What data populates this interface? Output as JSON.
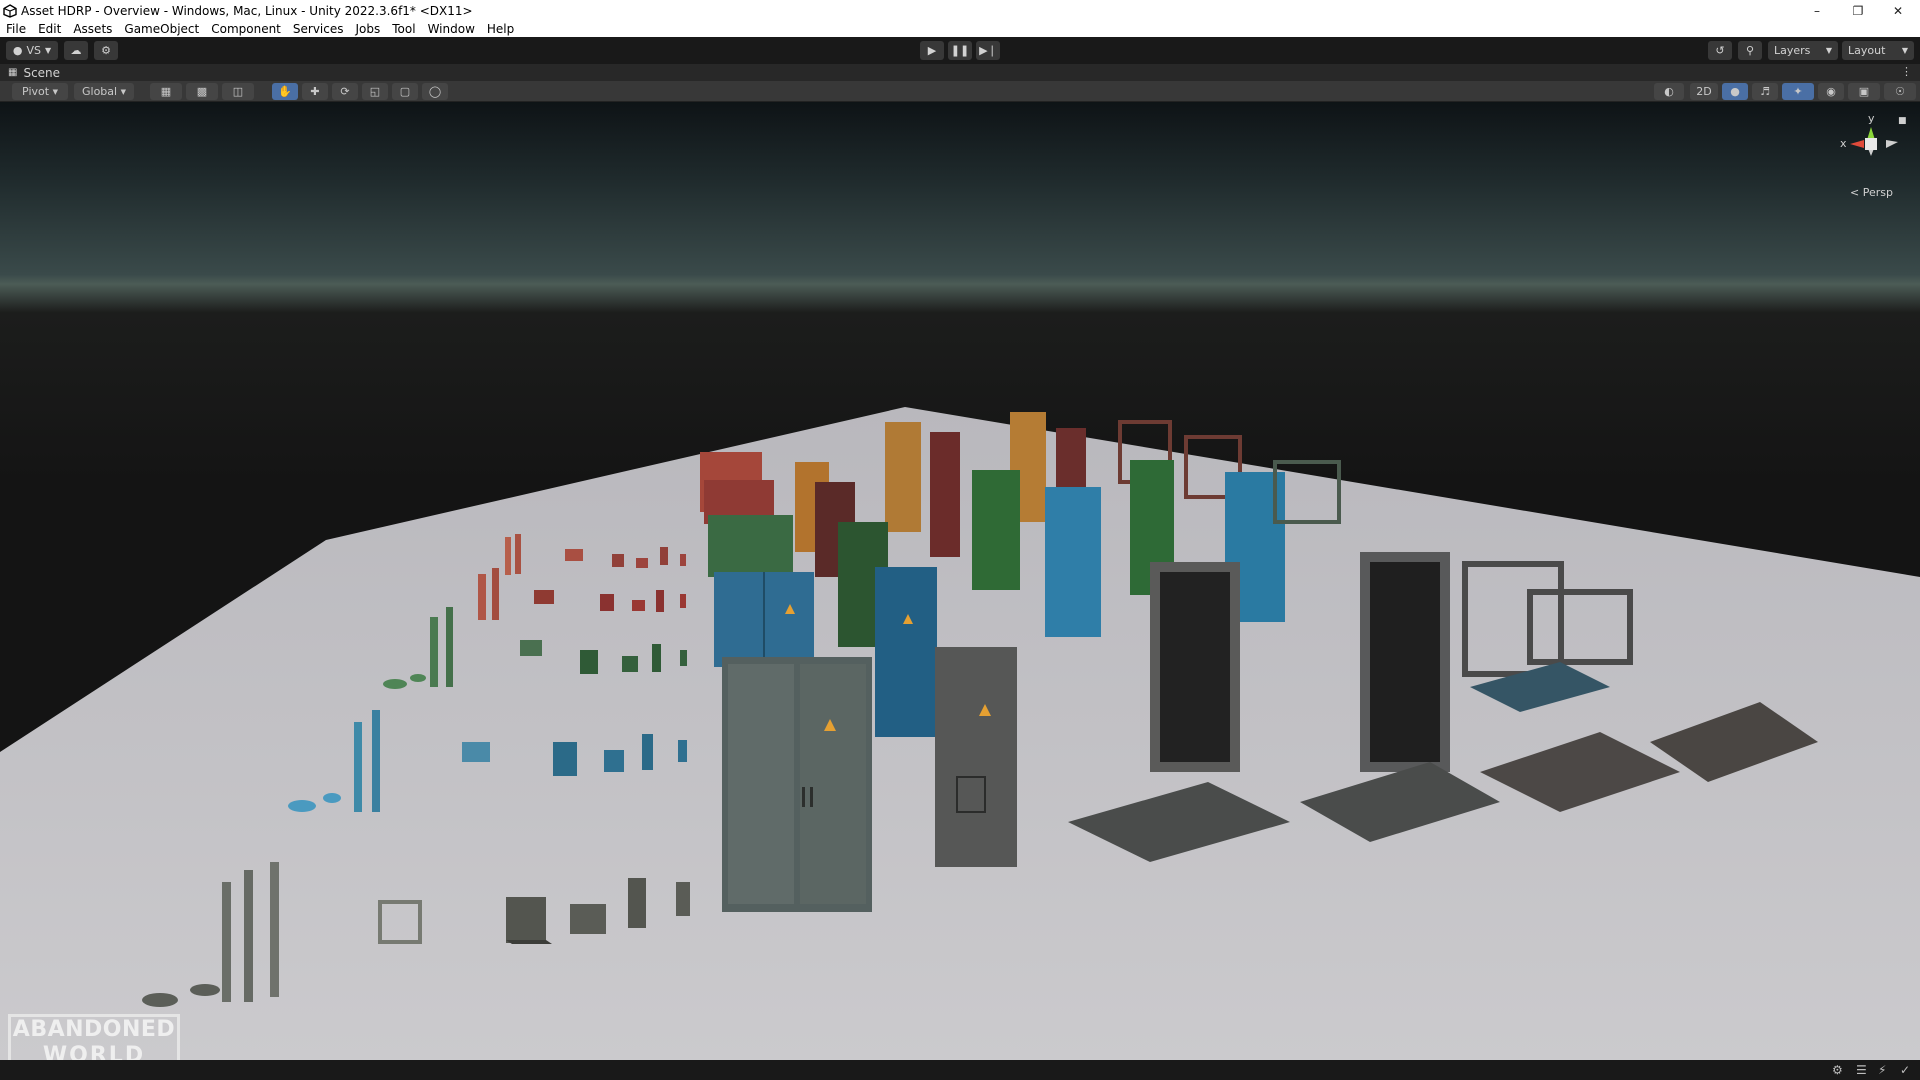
{
  "window": {
    "title": "Asset HDRP - Overview - Windows, Mac, Linux - Unity 2022.3.6f1* <DX11>"
  },
  "menu": [
    "File",
    "Edit",
    "Assets",
    "GameObject",
    "Component",
    "Services",
    "Jobs",
    "Tool",
    "Window",
    "Help"
  ],
  "toolbar": {
    "account_label": "VS",
    "layers_label": "Layers",
    "layout_label": "Layout"
  },
  "scene_tab": {
    "label": "Scene"
  },
  "scene_tools": {
    "pivot_label": "Pivot",
    "global_label": "Global",
    "mode_2d_label": "2D"
  },
  "gizmo": {
    "y_label": "y",
    "x_label": "x",
    "projection_label": "Persp"
  },
  "logo": {
    "line1": "ABANDONED",
    "line2": "WORLD"
  },
  "colors": {
    "unity_dark": "#191919",
    "panel": "#383838",
    "active_blue": "#4a6fa5",
    "floor": "#c9c8cc"
  },
  "icons": [
    "unity-icon",
    "minimize-icon",
    "restore-icon",
    "close-icon",
    "play-icon",
    "pause-icon",
    "step-icon",
    "cloud-icon",
    "settings-icon",
    "history-icon",
    "search-icon",
    "hand-tool-icon",
    "move-tool-icon",
    "rotate-tool-icon",
    "scale-tool-icon",
    "rect-tool-icon",
    "transform-tool-icon",
    "lighting-icon",
    "audio-icon",
    "effects-icon",
    "visibility-icon",
    "camera-icon",
    "gizmos-icon",
    "lock-icon"
  ]
}
